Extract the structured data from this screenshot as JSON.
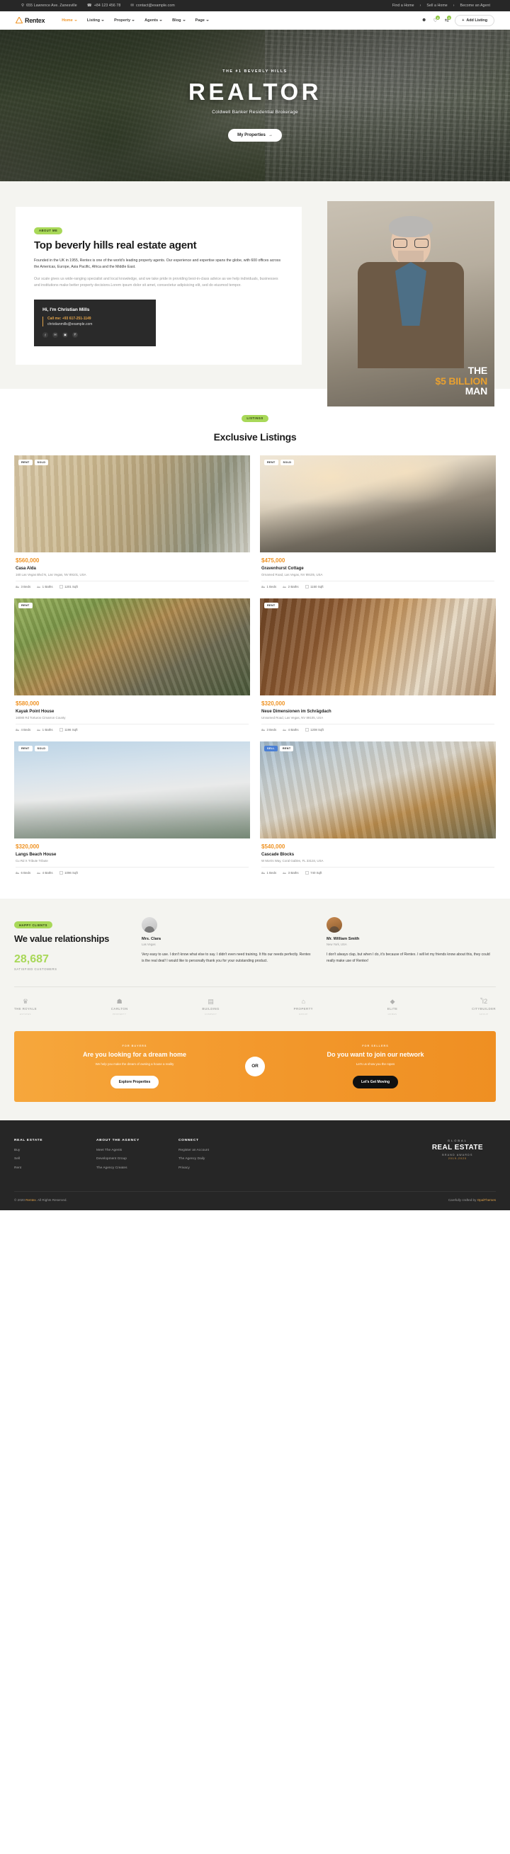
{
  "topbar": {
    "address": "655 Lawrence Ave. Zanesville",
    "phone": "+84 123 456 78",
    "email": "contact@example.com",
    "links": [
      "Find a Home",
      "Sell a Home",
      "Become an Agent"
    ],
    "sep": "›"
  },
  "nav": {
    "brand": "Rentex",
    "menu": [
      {
        "label": "Home",
        "active": true
      },
      {
        "label": "Listing",
        "active": false
      },
      {
        "label": "Property",
        "active": false
      },
      {
        "label": "Agents",
        "active": false
      },
      {
        "label": "Blog",
        "active": false
      },
      {
        "label": "Page",
        "active": false
      }
    ],
    "user_icon": "user-icon",
    "heart_icon": "heart-icon",
    "heart_count": "0",
    "compare_icon": "compare-icon",
    "compare_count": "0",
    "add_listing": "Add Listing",
    "add_icon": "+"
  },
  "hero": {
    "eyebrow": "THE #1 BEVERLY HILLS",
    "title": "REALTOR",
    "subtitle": "Coldwell Banker Residential Brokerage",
    "button": "My Properties",
    "button_icon": "→"
  },
  "about": {
    "pill": "ABOUT ME",
    "heading": "Top beverly hills real estate agent",
    "paragraph_1": "Founded in the UK in 1955, Rentex is one of the world's leading property agents. Our experience and expertise spans the globe, with 600 offices across the Americas, Europe, Asia Pacific, Africa and the Middle East.",
    "paragraph_2": "Our scale gives us wide-ranging specialist and local knowledge, and we take pride in providing best-in-class advice as we help individuals, businesses and institutions make better property decisions.Lorem ipsum dolor sit amet, consectetur adipisicing elit, sed do eiusmod tempor.",
    "contact_heading": "Hi, I'm Christian Mills",
    "contact_phone": "Call me: +93 617-251-1149",
    "contact_email": "christianmills@example.com",
    "socials": [
      "f",
      "✉",
      "▣",
      "Ⓟ"
    ],
    "photo_caption_1": "THE",
    "photo_caption_2": "$5 BILLION",
    "photo_caption_3": "MAN"
  },
  "listings": {
    "pill": "LISTINGS",
    "heading": "Exclusive Listings",
    "meta_icons": [
      "bed-icon",
      "bath-icon",
      "area-icon"
    ],
    "cards": [
      {
        "tags": [
          {
            "text": "RENT",
            "style": "white"
          },
          {
            "text": "SOLD",
            "style": "white"
          }
        ],
        "price": "$560,000",
        "name": "Casa Alda",
        "address": "160 Las Vegas Blvd N, Las Vegas, NV 89101, USA",
        "beds": "3 Beds",
        "baths": "1 Baths",
        "area": "1201 Sqft",
        "scene": "sc1"
      },
      {
        "tags": [
          {
            "text": "RENT",
            "style": "white"
          },
          {
            "text": "SOLD",
            "style": "white"
          }
        ],
        "price": "$475,000",
        "name": "Gravenhurst Cottage",
        "address": "Ornamed Road, Las Vegas, NV 89105, USA",
        "beds": "1 Beds",
        "baths": "2 Baths",
        "area": "1150 Sqft",
        "scene": "sc2"
      },
      {
        "tags": [
          {
            "text": "RENT",
            "style": "white"
          }
        ],
        "price": "$580,000",
        "name": "Kayak Point House",
        "address": "16080 Rd Torturos Cimarron County",
        "beds": "4 Beds",
        "baths": "1 Baths",
        "area": "1196 Sqft",
        "scene": "sc3"
      },
      {
        "tags": [
          {
            "text": "RENT",
            "style": "white"
          }
        ],
        "price": "$320,000",
        "name": "Neue Dimensionen im Schrägdach",
        "address": "Unnamed Road, Las Vegas, NV 89105, USA",
        "beds": "3 Beds",
        "baths": "4 Baths",
        "area": "1208 Sqft",
        "scene": "sc4"
      },
      {
        "tags": [
          {
            "text": "RENT",
            "style": "white"
          },
          {
            "text": "SOLD",
            "style": "white"
          }
        ],
        "price": "$320,000",
        "name": "Langs Beach House",
        "address": "Cu Rd X Tribute Tribute",
        "beds": "6 Beds",
        "baths": "4 Baths",
        "area": "1096 Sqft",
        "scene": "sc5"
      },
      {
        "tags": [
          {
            "text": "SELL",
            "style": "blue"
          },
          {
            "text": "RENT",
            "style": "white"
          }
        ],
        "price": "$540,000",
        "name": "Cascade Blocks",
        "address": "W Morris Way, Coral Gables, FL 33134, USA",
        "beds": "1 Beds",
        "baths": "3 Baths",
        "area": "740 Sqft",
        "scene": "sc6"
      }
    ]
  },
  "value": {
    "pill": "HAPPY CLIENTS",
    "heading": "We value relationships",
    "number": "28,687",
    "number_label": "SATISFIED CUSTOMERS",
    "testimonials": [
      {
        "name": "Mrs. Clara",
        "role": "Las Vegas",
        "text": "Very easy to use. I don't know what else to say. I didn't even need training. It fits our needs perfectly. Rentex is the real deal! I would like to personally thank you for your outstanding product.",
        "avatar": "avatar-clara"
      },
      {
        "name": "Mr. William Smith",
        "role": "New York, USA",
        "text": "I don't always clap, but when I do, it's because of Rentex. I will let my friends know about this, they could really make use of Rentex!",
        "avatar": "avatar-william"
      }
    ],
    "brands": [
      {
        "icon": "♛",
        "title": "THE ROYALE",
        "sub": "ESTATES"
      },
      {
        "icon": "☗",
        "title": "CARLTON",
        "sub": "PROPERTY"
      },
      {
        "icon": "▤",
        "title": "BUILDING",
        "sub": "COMPANY"
      },
      {
        "icon": "⌂",
        "title": "PROPERTY",
        "sub": "GROUP"
      },
      {
        "icon": "◆",
        "title": "ELITE",
        "sub": "HOMES"
      },
      {
        "icon": "Ἶ2",
        "title": "CITYBUILDER",
        "sub": "GROUP"
      }
    ]
  },
  "cta": {
    "left": {
      "eyebrow": "FOR BUYERS",
      "heading": "Are you looking for a dream home",
      "text": "We help you make the dream of owning a house a reality",
      "button": "Explore Properties"
    },
    "or": "OR",
    "right": {
      "eyebrow": "FOR SELLERS",
      "heading": "Do you want to join our network",
      "text": "Let's us show you the ropes",
      "button": "Let's Get Moving"
    }
  },
  "footer": {
    "columns": [
      {
        "title": "REAL ESTATE",
        "links": [
          "Buy",
          "Sell",
          "Rent"
        ]
      },
      {
        "title": "ABOUT THE AGENCY",
        "links": [
          "Meet The Agents",
          "Development Group",
          "The Agency Creates"
        ]
      },
      {
        "title": "CONNECT",
        "links": [
          "Register an Account",
          "The Agency Daily",
          "Privacy"
        ]
      }
    ],
    "brand_top": "GLOBAL",
    "brand_mid": "REAL ESTATE",
    "brand_sub": "BRAND AWARDS",
    "brand_year": "2019-2020",
    "copyright_pre": "© 2020",
    "copyright_brand": "Rentex",
    "copyright_post": ". All Rights Reserved.",
    "credit_pre": "Carefully crafted by ",
    "credit_brand": "OpalThemes"
  }
}
